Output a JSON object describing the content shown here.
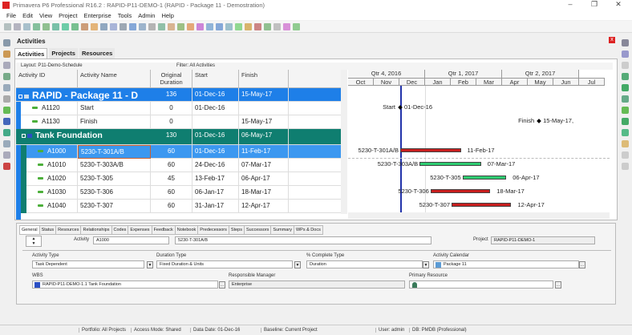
{
  "window": {
    "title": "Primavera P6 Professional R16.2 : RAPID-P11-DEMO-1 (RAPID - Package 11 - Demostration)",
    "minimize": "–",
    "maximize": "❐",
    "close": "✕"
  },
  "menu": [
    "File",
    "Edit",
    "View",
    "Project",
    "Enterprise",
    "Tools",
    "Admin",
    "Help"
  ],
  "panel": {
    "title": "Activities",
    "close": "x",
    "tabs": [
      "Activities",
      "Projects",
      "Resources"
    ],
    "layout": "Layout: P11-Demo-Schedule",
    "filter": "Filter: All Activities"
  },
  "columns": [
    "Activity ID",
    "Activity Name",
    "Original Duration",
    "Start",
    "Finish"
  ],
  "rows": [
    {
      "type": "wbs1",
      "id": "RAPID - Package 11 - D",
      "name": "",
      "dur": "136",
      "start": "01-Dec-16",
      "finish": "15-May-17"
    },
    {
      "type": "act",
      "id": "A1120",
      "name": "Start",
      "dur": "0",
      "start": "01-Dec-16",
      "finish": ""
    },
    {
      "type": "act",
      "id": "A1130",
      "name": "Finish",
      "dur": "0",
      "start": "",
      "finish": "15-May-17"
    },
    {
      "type": "wbs2",
      "id": "Tank Foundation",
      "name": "",
      "dur": "130",
      "start": "01-Dec-16",
      "finish": "06-May-17"
    },
    {
      "type": "sel",
      "id": "A1000",
      "name": "5230-T-301A/B",
      "dur": "60",
      "start": "01-Dec-16",
      "finish": "11-Feb-17"
    },
    {
      "type": "act",
      "id": "A1010",
      "name": "5230-T-303A/B",
      "dur": "60",
      "start": "24-Dec-16",
      "finish": "07-Mar-17"
    },
    {
      "type": "act",
      "id": "A1020",
      "name": "5230-T-305",
      "dur": "45",
      "start": "13-Feb-17",
      "finish": "06-Apr-17"
    },
    {
      "type": "act",
      "id": "A1030",
      "name": "5230-T-306",
      "dur": "60",
      "start": "06-Jan-17",
      "finish": "18-Mar-17"
    },
    {
      "type": "act",
      "id": "A1040",
      "name": "5230-T-307",
      "dur": "60",
      "start": "31-Jan-17",
      "finish": "12-Apr-17"
    }
  ],
  "gantt": {
    "quarters": [
      "Qtr 4, 2016",
      "Qtr 1, 2017",
      "Qtr 2, 2017"
    ],
    "months": [
      "Oct",
      "Nov",
      "Dec",
      "Jan",
      "Feb",
      "Mar",
      "Apr",
      "May",
      "Jun",
      "Jul"
    ],
    "milestones": [
      {
        "label": "Start",
        "date": "01-Dec-16",
        "row": 1,
        "side": "start",
        "day": 0
      },
      {
        "label": "Finish",
        "date": "15-May-17,",
        "row": 2,
        "side": "finish",
        "day": 165
      }
    ],
    "bars": [
      {
        "label": "5230-T-301A/B",
        "end": "11-Feb-17",
        "row": 4,
        "startDay": 0,
        "endDay": 72,
        "color": "#c81e1e"
      },
      {
        "label": "5230-T-303A/B",
        "end": "07-Mar-17",
        "row": 5,
        "startDay": 23,
        "endDay": 96,
        "color": "#2ecc71"
      },
      {
        "label": "5230-T-305",
        "end": "06-Apr-17",
        "row": 6,
        "startDay": 74,
        "endDay": 126,
        "color": "#2ecc71"
      },
      {
        "label": "5230-T-306",
        "end": "18-Mar-17",
        "row": 7,
        "startDay": 36,
        "endDay": 107,
        "color": "#c81e1e"
      },
      {
        "label": "5230-T-307",
        "end": "12-Apr-17",
        "row": 8,
        "startDay": 61,
        "endDay": 132,
        "color": "#c81e1e"
      }
    ]
  },
  "details": {
    "tabs": [
      "General",
      "Status",
      "Resources",
      "Relationships",
      "Codes",
      "Expenses",
      "Feedback",
      "Notebook",
      "Predecessors",
      "Steps",
      "Successors",
      "Summary",
      "WPs & Docs"
    ],
    "activity_label": "Activity",
    "activity_id": "A1000",
    "activity_name": "5230-T-301A/B",
    "project_label": "Project",
    "project": "RAPID-P11-DEMO-1",
    "activity_type_label": "Activity Type",
    "activity_type": "Task Dependent",
    "duration_type_label": "Duration Type",
    "duration_type": "Fixed Duration & Units",
    "pct_type_label": "% Complete Type",
    "pct_type": "Duration",
    "calendar_label": "Activity Calendar",
    "calendar": "Package 11",
    "wbs_label": "WBS",
    "wbs": "RAPID-P11-DEMO-1.1  Tank Foundation",
    "manager_label": "Responsible Manager",
    "manager": "Enterprise",
    "resource_label": "Primary Resource",
    "resource": ""
  },
  "status": {
    "portfolio": "Portfolio: All Projects",
    "access": "Access Mode: Shared",
    "datadate": "Data Date: 01-Dec-16",
    "baseline": "Baseline: Current Project",
    "user": "User: admin",
    "db": "DB: PMDB (Professional)"
  }
}
